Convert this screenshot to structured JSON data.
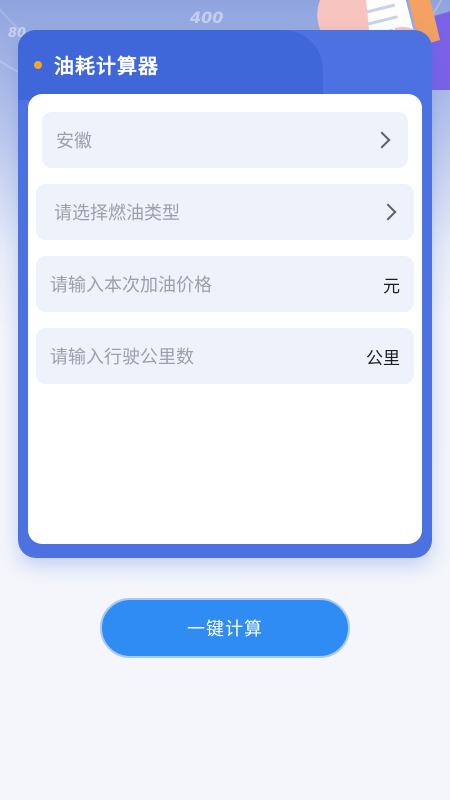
{
  "hero": {
    "gauge_labels": [
      "400",
      "80"
    ],
    "illustration_icon": "hand-holding-receipt-icon"
  },
  "card": {
    "title": "油耗计算器",
    "accent_color": "#f5a623",
    "card_color": "#4b72e0"
  },
  "fields": {
    "province": {
      "value": "安徽"
    },
    "fuel_type": {
      "placeholder": "请选择燃油类型"
    },
    "price": {
      "placeholder": "请输入本次加油价格",
      "unit": "元"
    },
    "distance": {
      "placeholder": "请输入行驶公里数",
      "unit": "公里"
    }
  },
  "calculate_button": {
    "label": "一键计算",
    "color": "#2e8cf2"
  }
}
